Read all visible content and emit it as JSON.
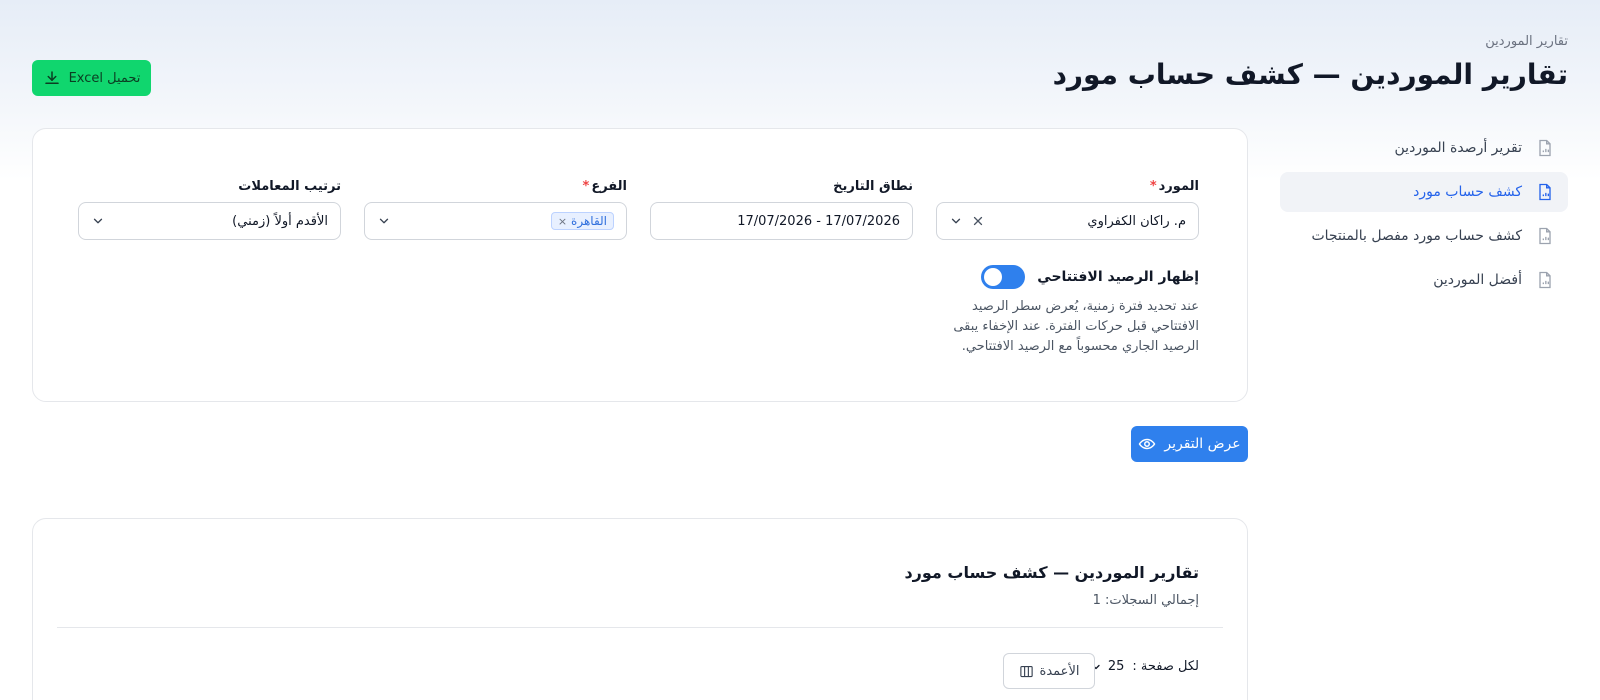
{
  "header": {
    "breadcrumb": "تقارير الموردين",
    "title": "تقارير الموردين — كشف حساب مورد",
    "excel_button": "تحميل Excel"
  },
  "sidebar": {
    "items": [
      {
        "label": "تقرير أرصدة الموردين",
        "icon": "report-file-icon",
        "active": false
      },
      {
        "label": "كشف حساب مورد",
        "icon": "report-file-icon",
        "active": true
      },
      {
        "label": "كشف حساب مورد مفصل بالمنتجات",
        "icon": "report-file-icon",
        "active": false
      },
      {
        "label": "أفضل الموردين",
        "icon": "report-file-icon",
        "active": false
      }
    ]
  },
  "filters": {
    "supplier": {
      "label": "المورد",
      "required": "*",
      "value": "م. راكان الكفراوي"
    },
    "date_range": {
      "label": "نطاق التاريخ",
      "value": "17/07/2026 - 17/07/2026"
    },
    "branch": {
      "label": "الفرع",
      "required": "*",
      "tag": "القاهرة",
      "tag_remove": "×"
    },
    "order": {
      "label": "ترتيب المعاملات",
      "value": "الأقدم أولاً (زمني)"
    },
    "opening_balance": {
      "label": "إظهار الرصيد الافتتاحي",
      "enabled": true,
      "help": "عند تحديد فترة زمنية، يُعرض سطر الرصيد الافتتاحي قبل حركات الفترة. عند الإخفاء يبقى الرصيد الجاري محسوباً مع الرصيد الافتتاحي."
    }
  },
  "actions": {
    "show_report": "عرض التقرير"
  },
  "results": {
    "title": "تقارير الموردين — كشف حساب مورد",
    "total_records": "إجمالي السجلات: 1",
    "per_page_label": "لكل صفحة :",
    "per_page_value": "25",
    "columns_button": "الأعمدة"
  },
  "colors": {
    "primary": "#2f80ed",
    "excel": "#10d66e",
    "required": "#ef4444"
  }
}
